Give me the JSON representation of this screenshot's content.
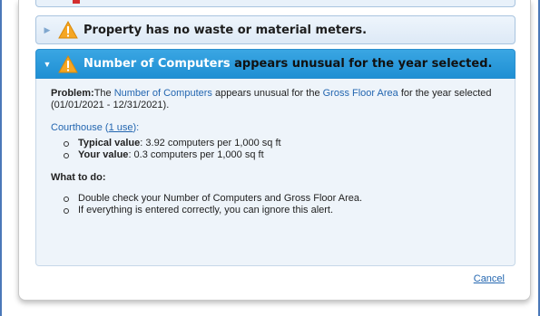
{
  "alerts": [
    {
      "text": "Property has no waste or material meters.",
      "state": "collapsed"
    },
    {
      "highlight": "Number of Computers",
      "text": " appears unusual for the year selected.",
      "state": "expanded"
    }
  ],
  "detail": {
    "problem_label": "Problem:",
    "problem_pre": "The ",
    "problem_link1": "Number of Computers",
    "problem_mid": " appears unusual for the ",
    "problem_link2": "Gross Floor Area",
    "problem_post": " for the year selected (01/01/2021 - 12/31/2021).",
    "use_name": "Courthouse (",
    "use_link": "1 use",
    "use_close": "):",
    "values": [
      {
        "label": "Typical value",
        "text": ": 3.92 computers per 1,000 sq ft"
      },
      {
        "label": "Your value",
        "text": ": 0.3 computers per 1,000 sq ft"
      }
    ],
    "todo_heading": "What to do:",
    "todo_items": [
      "Double check your Number of Computers and Gross Floor Area.",
      "If everything is entered correctly, you can ignore this alert."
    ]
  },
  "footer": {
    "cancel_label": "Cancel"
  },
  "colors": {
    "header_expanded": "#1f8fd3",
    "link": "#2366b0",
    "warning": "#f5a623"
  },
  "icons": [
    "expand-arrow-icon",
    "warning-icon",
    "collapse-arrow-icon"
  ]
}
